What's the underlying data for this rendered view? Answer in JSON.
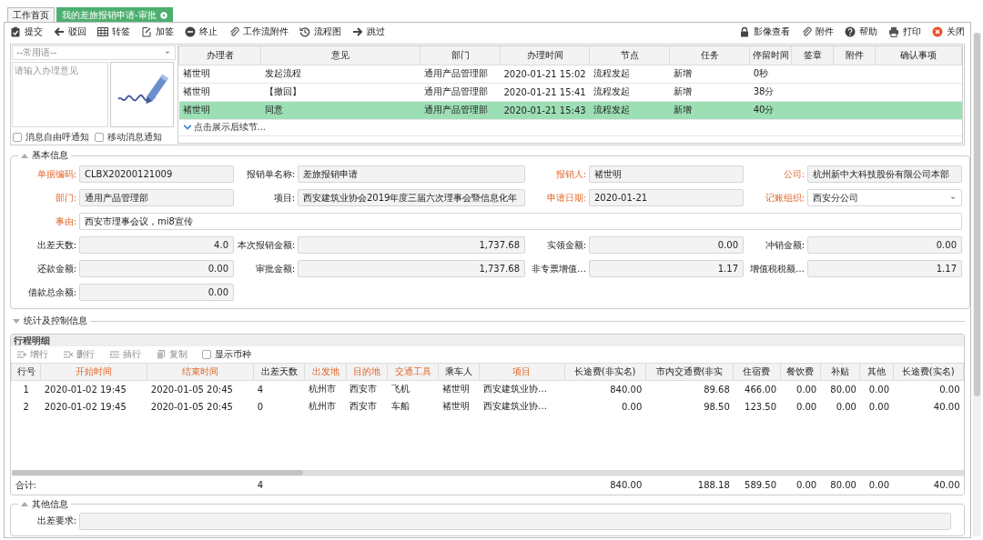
{
  "tabs": [
    {
      "label": "工作首页",
      "selected": false,
      "closable": false
    },
    {
      "label": "我的差旅报销申请-审批",
      "selected": true,
      "closable": true
    }
  ],
  "toolbar": {
    "left": [
      "提交",
      "驳回",
      "转签",
      "加签",
      "终止",
      "工作流附件",
      "流程图",
      "跳过"
    ],
    "right": [
      "影像查看",
      "附件",
      "帮助",
      "打印",
      "关闭"
    ]
  },
  "approval": {
    "phrase_select": {
      "placeholder": "--常用语--"
    },
    "opinion": {
      "placeholder": "请输入办理意见"
    },
    "notifications": [
      {
        "label": "消息自由呼通知",
        "checked": false
      },
      {
        "label": "移动消息通知",
        "checked": false
      }
    ],
    "columns": [
      "办理者",
      "意见",
      "部门",
      "办理时间",
      "节点",
      "任务",
      "停留时间",
      "签章",
      "附件",
      "确认事项"
    ],
    "rows": [
      {
        "cells": [
          "褚世明",
          "发起流程",
          "通用产品管理部",
          "2020-01-21 15:02",
          "流程发起",
          "新增",
          "0秒"
        ],
        "selected": false
      },
      {
        "cells": [
          "褚世明",
          "【撤回】",
          "通用产品管理部",
          "2020-01-21 15:41",
          "流程发起",
          "新增",
          "38分"
        ],
        "selected": false
      },
      {
        "cells": [
          "褚世明",
          "同意",
          "通用产品管理部",
          "2020-01-21 15:43",
          "流程发起",
          "新增",
          "40分"
        ],
        "selected": true
      }
    ],
    "expand_link": "点击展示后续节..."
  },
  "basic_info": {
    "title": "基本信息",
    "expanded": true,
    "fields": [
      {
        "label": "单据编码:",
        "value": "CLBX20200121009",
        "required": true,
        "kind": "text"
      },
      {
        "label": "报销单名称:",
        "value": "差旅报销申请",
        "required": false,
        "kind": "text"
      },
      {
        "label": "报销人:",
        "value": "褚世明",
        "required": true,
        "kind": "text"
      },
      {
        "label": "公司:",
        "value": "杭州新中大科技股份有限公司本部",
        "required": true,
        "kind": "text"
      },
      {
        "label": "部门:",
        "value": "通用产品管理部",
        "required": true,
        "kind": "text"
      },
      {
        "label": "项目:",
        "value": "西安建筑业协会2019年度三届六次理事会暨信息化年",
        "required": false,
        "kind": "text"
      },
      {
        "label": "申请日期:",
        "value": "2020-01-21",
        "required": true,
        "kind": "text"
      },
      {
        "label": "记账组织:",
        "value": "西安分公司",
        "required": true,
        "kind": "select"
      },
      {
        "label": "事由:",
        "value": "西安市理事会议，mi8宣传",
        "required": true,
        "kind": "wide"
      },
      {
        "label": "出差天数:",
        "value": "4.0",
        "required": false,
        "kind": "amount"
      },
      {
        "label": "本次报销金额:",
        "value": "1,737.68",
        "required": false,
        "kind": "amount"
      },
      {
        "label": "实领金额:",
        "value": "0.00",
        "required": false,
        "kind": "amount"
      },
      {
        "label": "冲销金额:",
        "value": "0.00",
        "required": false,
        "kind": "amount"
      },
      {
        "label": "还款金额:",
        "value": "0.00",
        "required": false,
        "kind": "amount"
      },
      {
        "label": "审批金额:",
        "value": "1,737.68",
        "required": false,
        "kind": "amount"
      },
      {
        "label": "非专票增值…",
        "value": "1.17",
        "required": false,
        "kind": "amount"
      },
      {
        "label": "增值税税额…",
        "value": "1.17",
        "required": false,
        "kind": "amount"
      },
      {
        "label": "借款总余额:",
        "value": "0.00",
        "required": false,
        "kind": "amount"
      }
    ]
  },
  "stats_section": {
    "title": "统计及控制信息",
    "expanded": false
  },
  "trip_detail": {
    "title": "行程明细",
    "actions": [
      {
        "label": "增行",
        "disabled": true
      },
      {
        "label": "删行",
        "disabled": true
      },
      {
        "label": "插行",
        "disabled": true
      },
      {
        "label": "复制",
        "disabled": true
      }
    ],
    "show_currency": {
      "label": "显示币种",
      "checked": false
    },
    "columns": [
      {
        "label": "行号",
        "required": false,
        "kind": "text"
      },
      {
        "label": "开始时间",
        "required": true,
        "kind": "text"
      },
      {
        "label": "结束时间",
        "required": true,
        "kind": "text"
      },
      {
        "label": "出差天数",
        "required": false,
        "kind": "text"
      },
      {
        "label": "出发地",
        "required": true,
        "kind": "text"
      },
      {
        "label": "目的地",
        "required": true,
        "kind": "text"
      },
      {
        "label": "交通工具",
        "required": true,
        "kind": "text"
      },
      {
        "label": "乘车人",
        "required": false,
        "kind": "text"
      },
      {
        "label": "项目",
        "required": true,
        "kind": "text"
      },
      {
        "label": "长途费(非实名)",
        "required": false,
        "kind": "amount"
      },
      {
        "label": "市内交通费(非实",
        "required": false,
        "kind": "amount"
      },
      {
        "label": "住宿费",
        "required": false,
        "kind": "amount"
      },
      {
        "label": "餐饮费",
        "required": false,
        "kind": "amount"
      },
      {
        "label": "补贴",
        "required": false,
        "kind": "amount"
      },
      {
        "label": "其他",
        "required": false,
        "kind": "amount"
      },
      {
        "label": "长途费(实名)",
        "required": false,
        "kind": "amount"
      }
    ],
    "rows": [
      [
        "1",
        "2020-01-02 19:45",
        "2020-01-05 20:45",
        "4",
        "杭州市",
        "西安市",
        "飞机",
        "褚世明",
        "西安建筑业协…",
        "840.00",
        "89.68",
        "466.00",
        "0.00",
        "80.00",
        "0.00",
        "0.00"
      ],
      [
        "2",
        "2020-01-02 19:45",
        "2020-01-05 20:45",
        "0",
        "杭州市",
        "西安市",
        "车船",
        "褚世明",
        "西安建筑业协…",
        "0.00",
        "98.50",
        "123.50",
        "0.00",
        "0.00",
        "0.00",
        "40.00"
      ]
    ],
    "totals": {
      "label": "合计:",
      "days": "4",
      "amounts": [
        "840.00",
        "188.18",
        "589.50",
        "0.00",
        "80.00",
        "0.00",
        "40.00"
      ]
    }
  },
  "other_info": {
    "title": "其他信息",
    "expanded": true,
    "fields": [
      {
        "label": "出差要求:"
      }
    ]
  }
}
